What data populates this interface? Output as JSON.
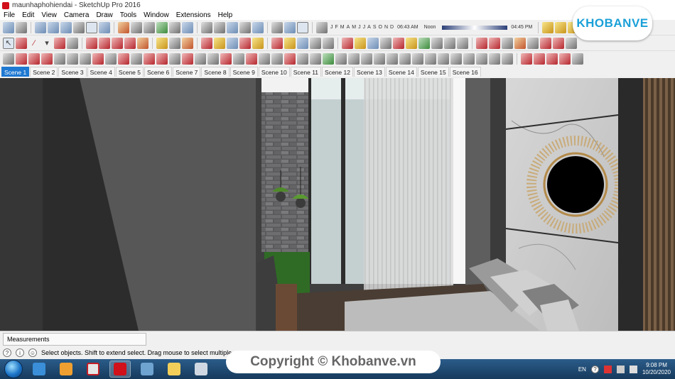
{
  "window": {
    "title": "maunhaphohiendai - SketchUp Pro 2016"
  },
  "menu": [
    "File",
    "Edit",
    "View",
    "Camera",
    "Draw",
    "Tools",
    "Window",
    "Extensions",
    "Help"
  ],
  "shadows": {
    "months": [
      "J",
      "F",
      "M",
      "A",
      "M",
      "J",
      "J",
      "A",
      "S",
      "O",
      "N",
      "D"
    ],
    "time_start": "06:43 AM",
    "time_mid": "Noon",
    "time_end": "04:45 PM"
  },
  "scenes": [
    "Scene 1",
    "Scene 2",
    "Scene 3",
    "Scene 4",
    "Scene 5",
    "Scene 6",
    "Scene 7",
    "Scene 8",
    "Scene 9",
    "Scene 10",
    "Scene 11",
    "Scene 12",
    "Scene 13",
    "Scene 14",
    "Scene 15",
    "Scene 16"
  ],
  "active_scene": "Scene 1",
  "measurements": {
    "label": "Measurements"
  },
  "status": {
    "text": "Select objects. Shift to extend select. Drag mouse to select multiple."
  },
  "taskbar": {
    "language": "EN",
    "time": "9:08 PM",
    "date": "10/20/2020"
  },
  "branding": {
    "logo_text": "KHOBANVE",
    "watermark": "Copyright © Khobanve.vn"
  },
  "colors": {
    "accent_tab": "#1f78d1",
    "logo_orange": "#f07a1a",
    "logo_blue": "#1aa0d8"
  }
}
